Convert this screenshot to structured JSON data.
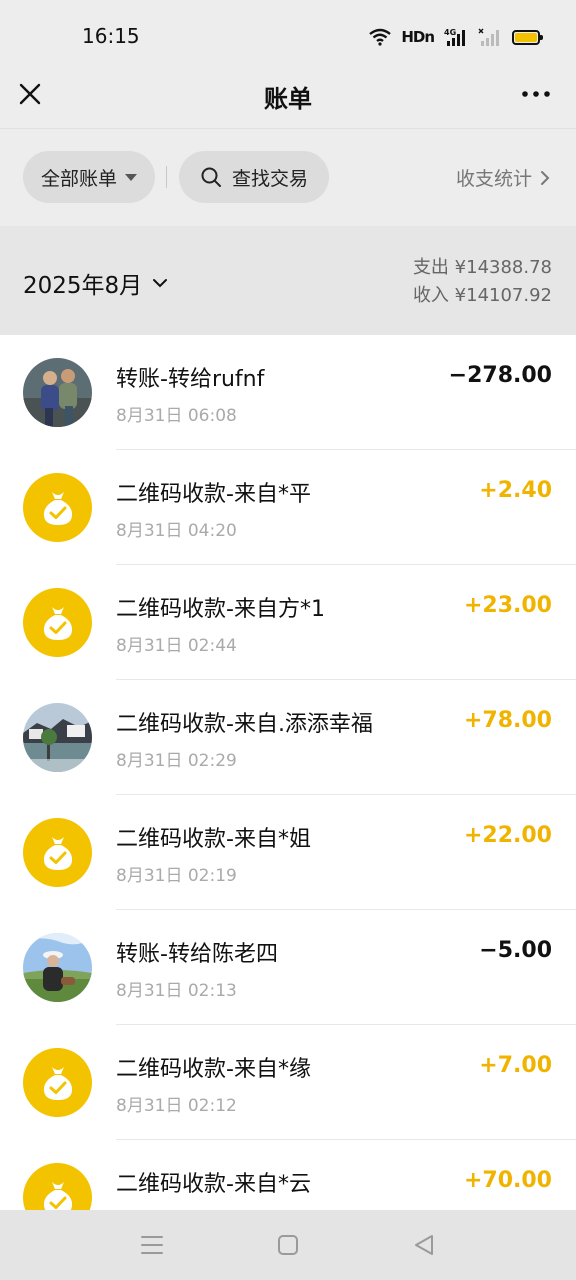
{
  "status_bar": {
    "time": "16:15",
    "hd": "HDn",
    "net": "4G"
  },
  "header": {
    "title": "账单"
  },
  "filters": {
    "all_label": "全部账单",
    "search_label": "查找交易",
    "stats_label": "收支统计"
  },
  "month_header": {
    "month": "2025年8月",
    "expense": "支出 ¥14388.78",
    "income": "收入 ¥14107.92"
  },
  "colors": {
    "accent": "#f3c300",
    "income": "#f0b400"
  },
  "transactions": [
    {
      "name": "转账-转给rufnf",
      "date": "8月31日 06:08",
      "amount": "−278.00",
      "type": "expense",
      "avatar": "photo-two-people"
    },
    {
      "name": "二维码收款-来自*平",
      "date": "8月31日 04:20",
      "amount": "+2.40",
      "type": "income",
      "avatar": "money-bag-icon"
    },
    {
      "name": "二维码收款-来自方*1",
      "date": "8月31日 02:44",
      "amount": "+23.00",
      "type": "income",
      "avatar": "money-bag-icon"
    },
    {
      "name": "二维码收款-来自.添添幸福",
      "date": "8月31日 02:29",
      "amount": "+78.00",
      "type": "income",
      "avatar": "photo-landscape"
    },
    {
      "name": "二维码收款-来自*姐",
      "date": "8月31日 02:19",
      "amount": "+22.00",
      "type": "income",
      "avatar": "money-bag-icon"
    },
    {
      "name": "转账-转给陈老四",
      "date": "8月31日 02:13",
      "amount": "−5.00",
      "type": "expense",
      "avatar": "photo-person-grassland"
    },
    {
      "name": "二维码收款-来自*缘",
      "date": "8月31日 02:12",
      "amount": "+7.00",
      "type": "income",
      "avatar": "money-bag-icon"
    },
    {
      "name": "二维码收款-来自*云",
      "date": "",
      "amount": "+70.00",
      "type": "income",
      "avatar": "money-bag-icon"
    }
  ]
}
